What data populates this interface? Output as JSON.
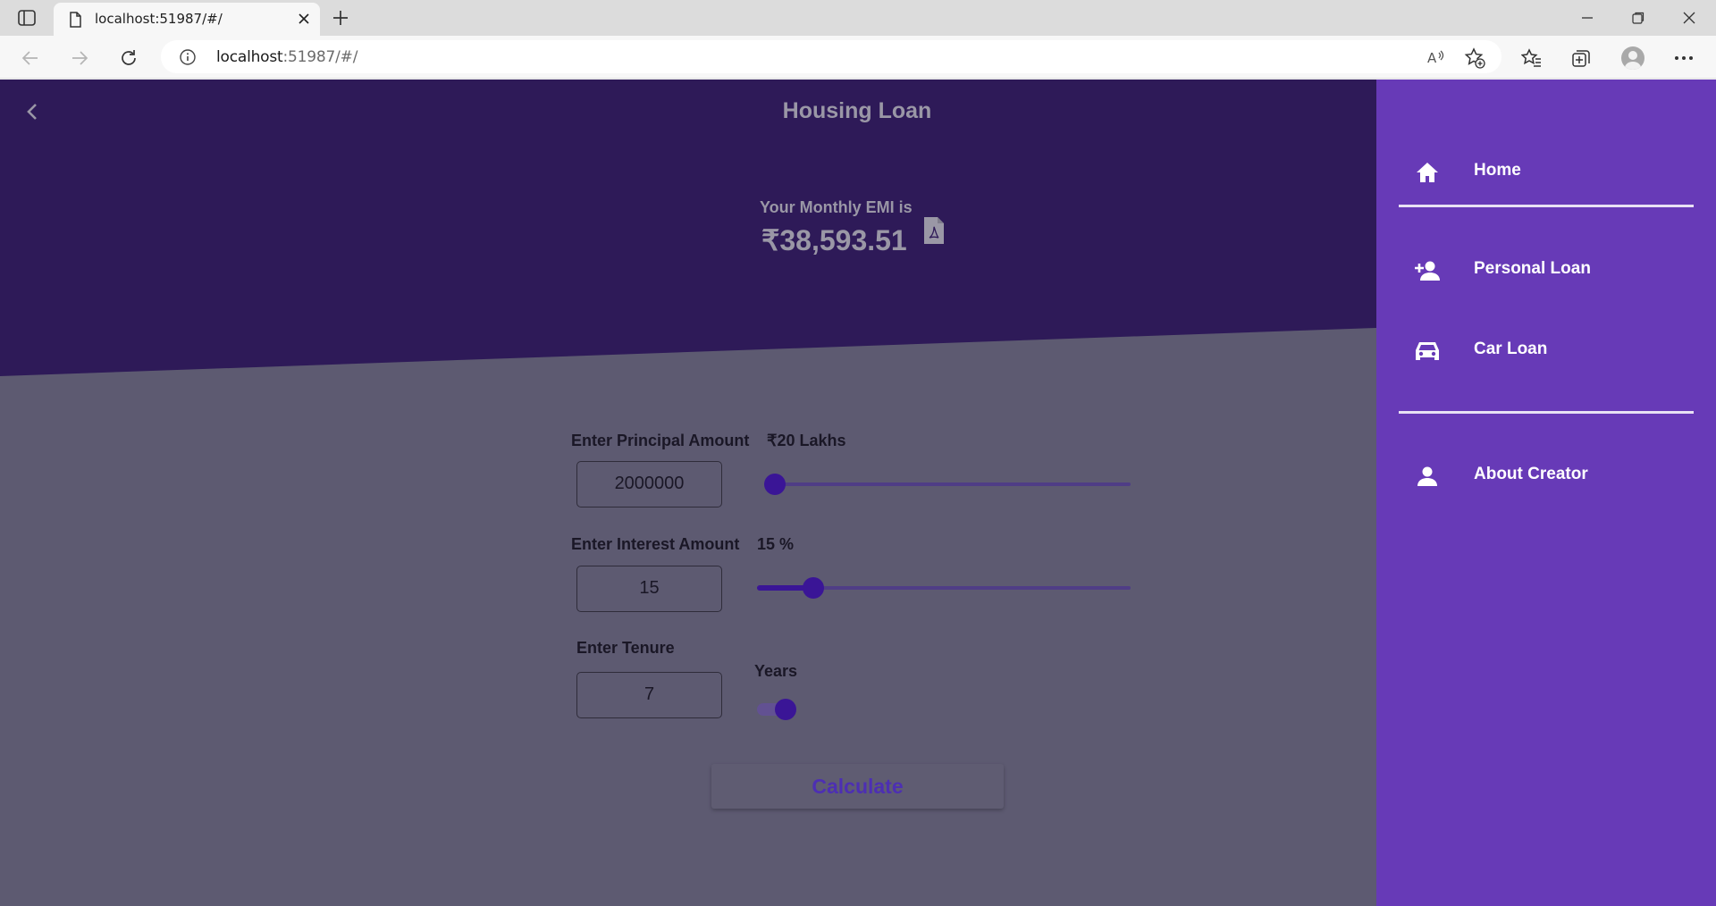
{
  "browser": {
    "tab_title": "localhost:51987/#/",
    "url_host": "localhost",
    "url_rest": ":51987/#/"
  },
  "app": {
    "page_title": "Housing Loan",
    "emi_label": "Your Monthly EMI is",
    "emi_value": "₹38,593.51",
    "principal": {
      "label": "Enter Principal Amount",
      "display": "₹20 Lakhs",
      "value": "2000000",
      "slider_fraction": 0.0
    },
    "interest": {
      "label": "Enter Interest Amount",
      "display": "15 %",
      "value": "15",
      "slider_fraction": 0.15
    },
    "tenure": {
      "label": "Enter Tenure",
      "value": "7",
      "unit_label": "Years",
      "unit_toggle_on": true
    },
    "calculate_label": "Calculate"
  },
  "drawer": {
    "items": [
      {
        "label": "Home",
        "icon": "home-icon"
      },
      {
        "label": "Personal Loan",
        "icon": "person-add-icon"
      },
      {
        "label": "Car Loan",
        "icon": "car-icon"
      },
      {
        "label": "About Creator",
        "icon": "person-icon"
      }
    ]
  },
  "colors": {
    "header": "#2e1a58",
    "content_scrim": "#5d5a71",
    "drawer": "#673ab7",
    "accent": "#3a1596"
  }
}
